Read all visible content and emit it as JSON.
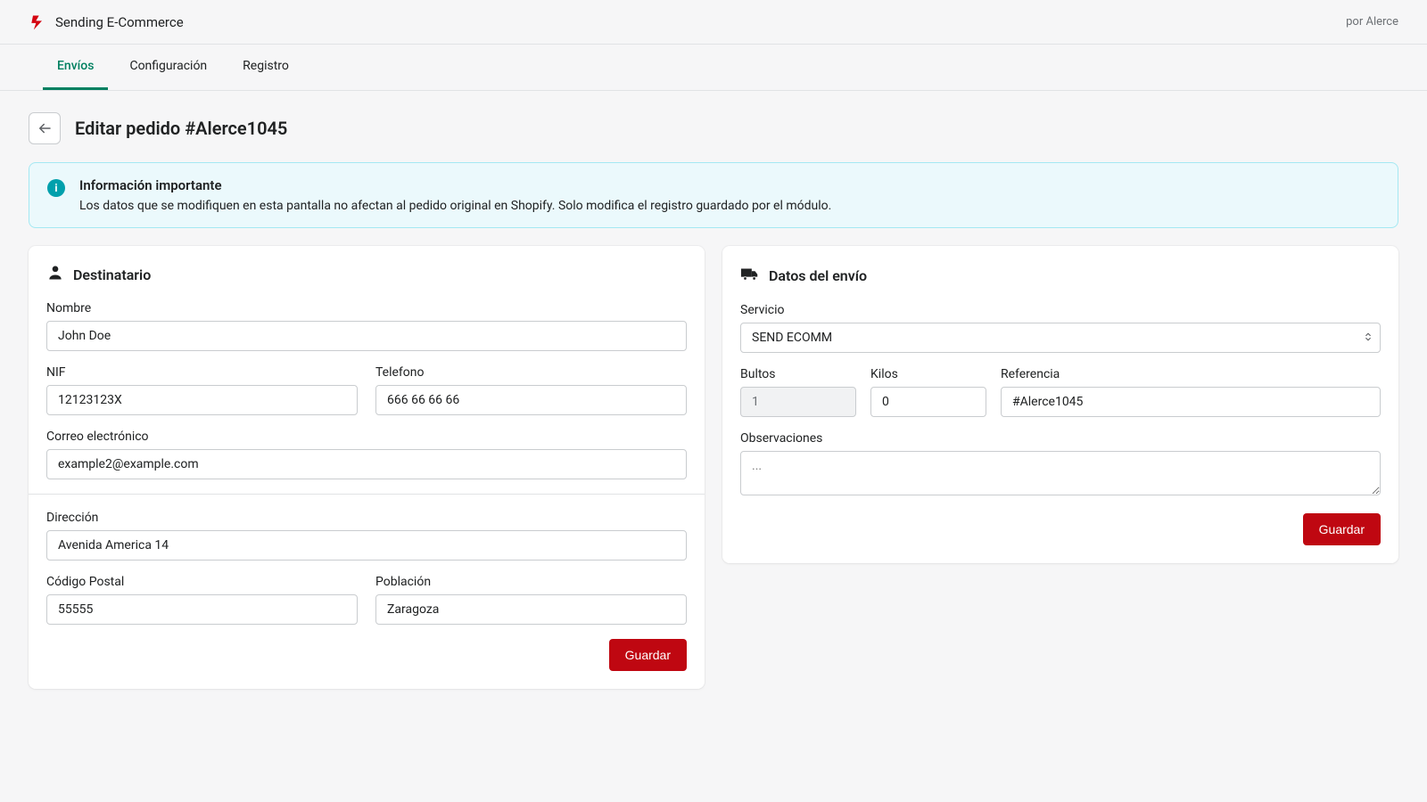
{
  "header": {
    "app_name": "Sending E-Commerce",
    "vendor": "por Alerce"
  },
  "tabs": {
    "items": [
      "Envíos",
      "Configuración",
      "Registro"
    ],
    "active_index": 0
  },
  "page": {
    "title": "Editar pedido #Alerce1045"
  },
  "alert": {
    "title": "Información importante",
    "text": "Los datos que se modifiquen en esta pantalla no afectan al pedido original en Shopify. Solo modifica el registro guardado por el módulo."
  },
  "recipient": {
    "card_title": "Destinatario",
    "labels": {
      "name": "Nombre",
      "nif": "NIF",
      "phone": "Telefono",
      "email": "Correo electrónico",
      "address": "Dirección",
      "postal": "Código Postal",
      "city": "Población"
    },
    "values": {
      "name": "John Doe",
      "nif": "12123123X",
      "phone": "666 66 66 66",
      "email": "example2@example.com",
      "address": "Avenida America 14",
      "postal": "55555",
      "city": "Zaragoza"
    },
    "save_label": "Guardar"
  },
  "shipment": {
    "card_title": "Datos del envío",
    "labels": {
      "service": "Servicio",
      "packages": "Bultos",
      "kilos": "Kilos",
      "reference": "Referencia",
      "notes": "Observaciones"
    },
    "values": {
      "service": "SEND ECOMM",
      "packages": "1",
      "kilos": "0",
      "reference": "#Alerce1045",
      "notes": ""
    },
    "notes_placeholder": "...",
    "save_label": "Guardar"
  },
  "colors": {
    "accent": "#008060",
    "danger": "#bf0711",
    "info": "#00a0ac",
    "info_bg": "#ebf9fc"
  }
}
